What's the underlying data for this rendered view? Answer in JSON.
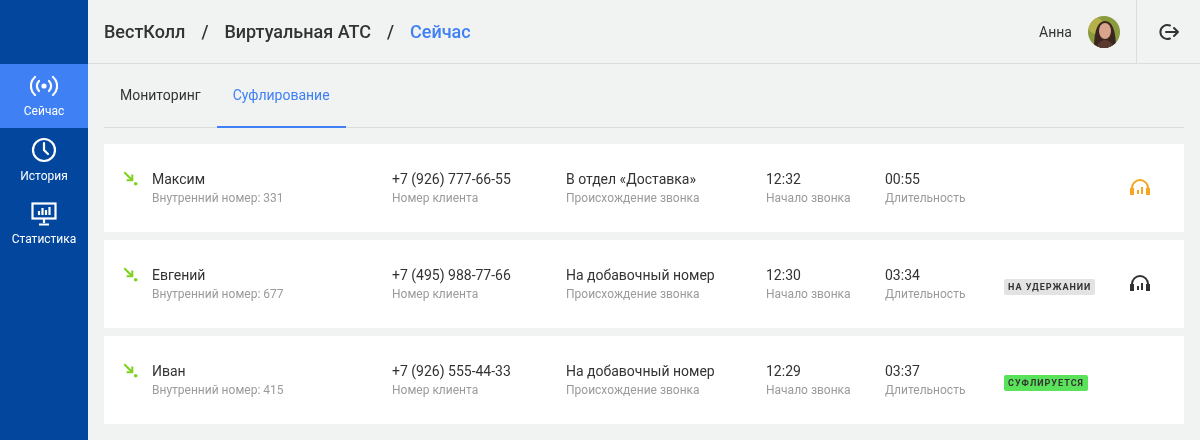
{
  "sidebar": {
    "items": [
      {
        "label": "Сейчас",
        "kind": "broadcast",
        "selected": true
      },
      {
        "label": "История",
        "kind": "clock",
        "selected": false
      },
      {
        "label": "Статистика",
        "kind": "monitor",
        "selected": false
      }
    ]
  },
  "breadcrumbs": [
    {
      "label": "ВестКолл",
      "current": false
    },
    {
      "label": "Виртуальная АТС",
      "current": false
    },
    {
      "label": "Сейчас",
      "current": true
    }
  ],
  "separator": "/",
  "user": {
    "name": "Анна"
  },
  "tabs": [
    {
      "label": "Мониторинг",
      "selected": false
    },
    {
      "label": "Суфлирование",
      "selected": true
    }
  ],
  "calls": [
    {
      "name": "Максим",
      "extension": "Внутренний номер: 331",
      "phone": "+7 (926) 777-66-55",
      "phone_label": "Номер клиента",
      "origin": "В отдел «Доставка»",
      "origin_label": "Происхождение звонка",
      "start": "12:32",
      "start_label": "Начало звонка",
      "duration": "00:55",
      "duration_label": "Длительность",
      "listener": {
        "kind": "active"
      }
    },
    {
      "name": "Евгений",
      "extension": "Внутренний номер: 677",
      "phone": "+7 (495) 988-77-66",
      "phone_label": "Номер клиента",
      "origin": "На добавочный номер",
      "origin_label": "Происхождение звонка",
      "start": "12:30",
      "start_label": "Начало звонка",
      "duration": "03:34",
      "duration_label": "Длительность",
      "status": {
        "kind": "hold",
        "label": "НА УДЕРЖАНИИ"
      },
      "listener": {
        "kind": "idle"
      }
    },
    {
      "name": "Иван",
      "extension": "Внутренний номер: 415",
      "phone": "+7 (926) 555-44-33",
      "phone_label": "Номер клиента",
      "origin": "На добавочный номер",
      "origin_label": "Происхождение звонка",
      "start": "12:29",
      "start_label": "Начало звонка",
      "duration": "03:37",
      "duration_label": "Длительность",
      "status": {
        "kind": "prompting",
        "label": "СУФЛИРУЕТСЯ"
      }
    }
  ]
}
